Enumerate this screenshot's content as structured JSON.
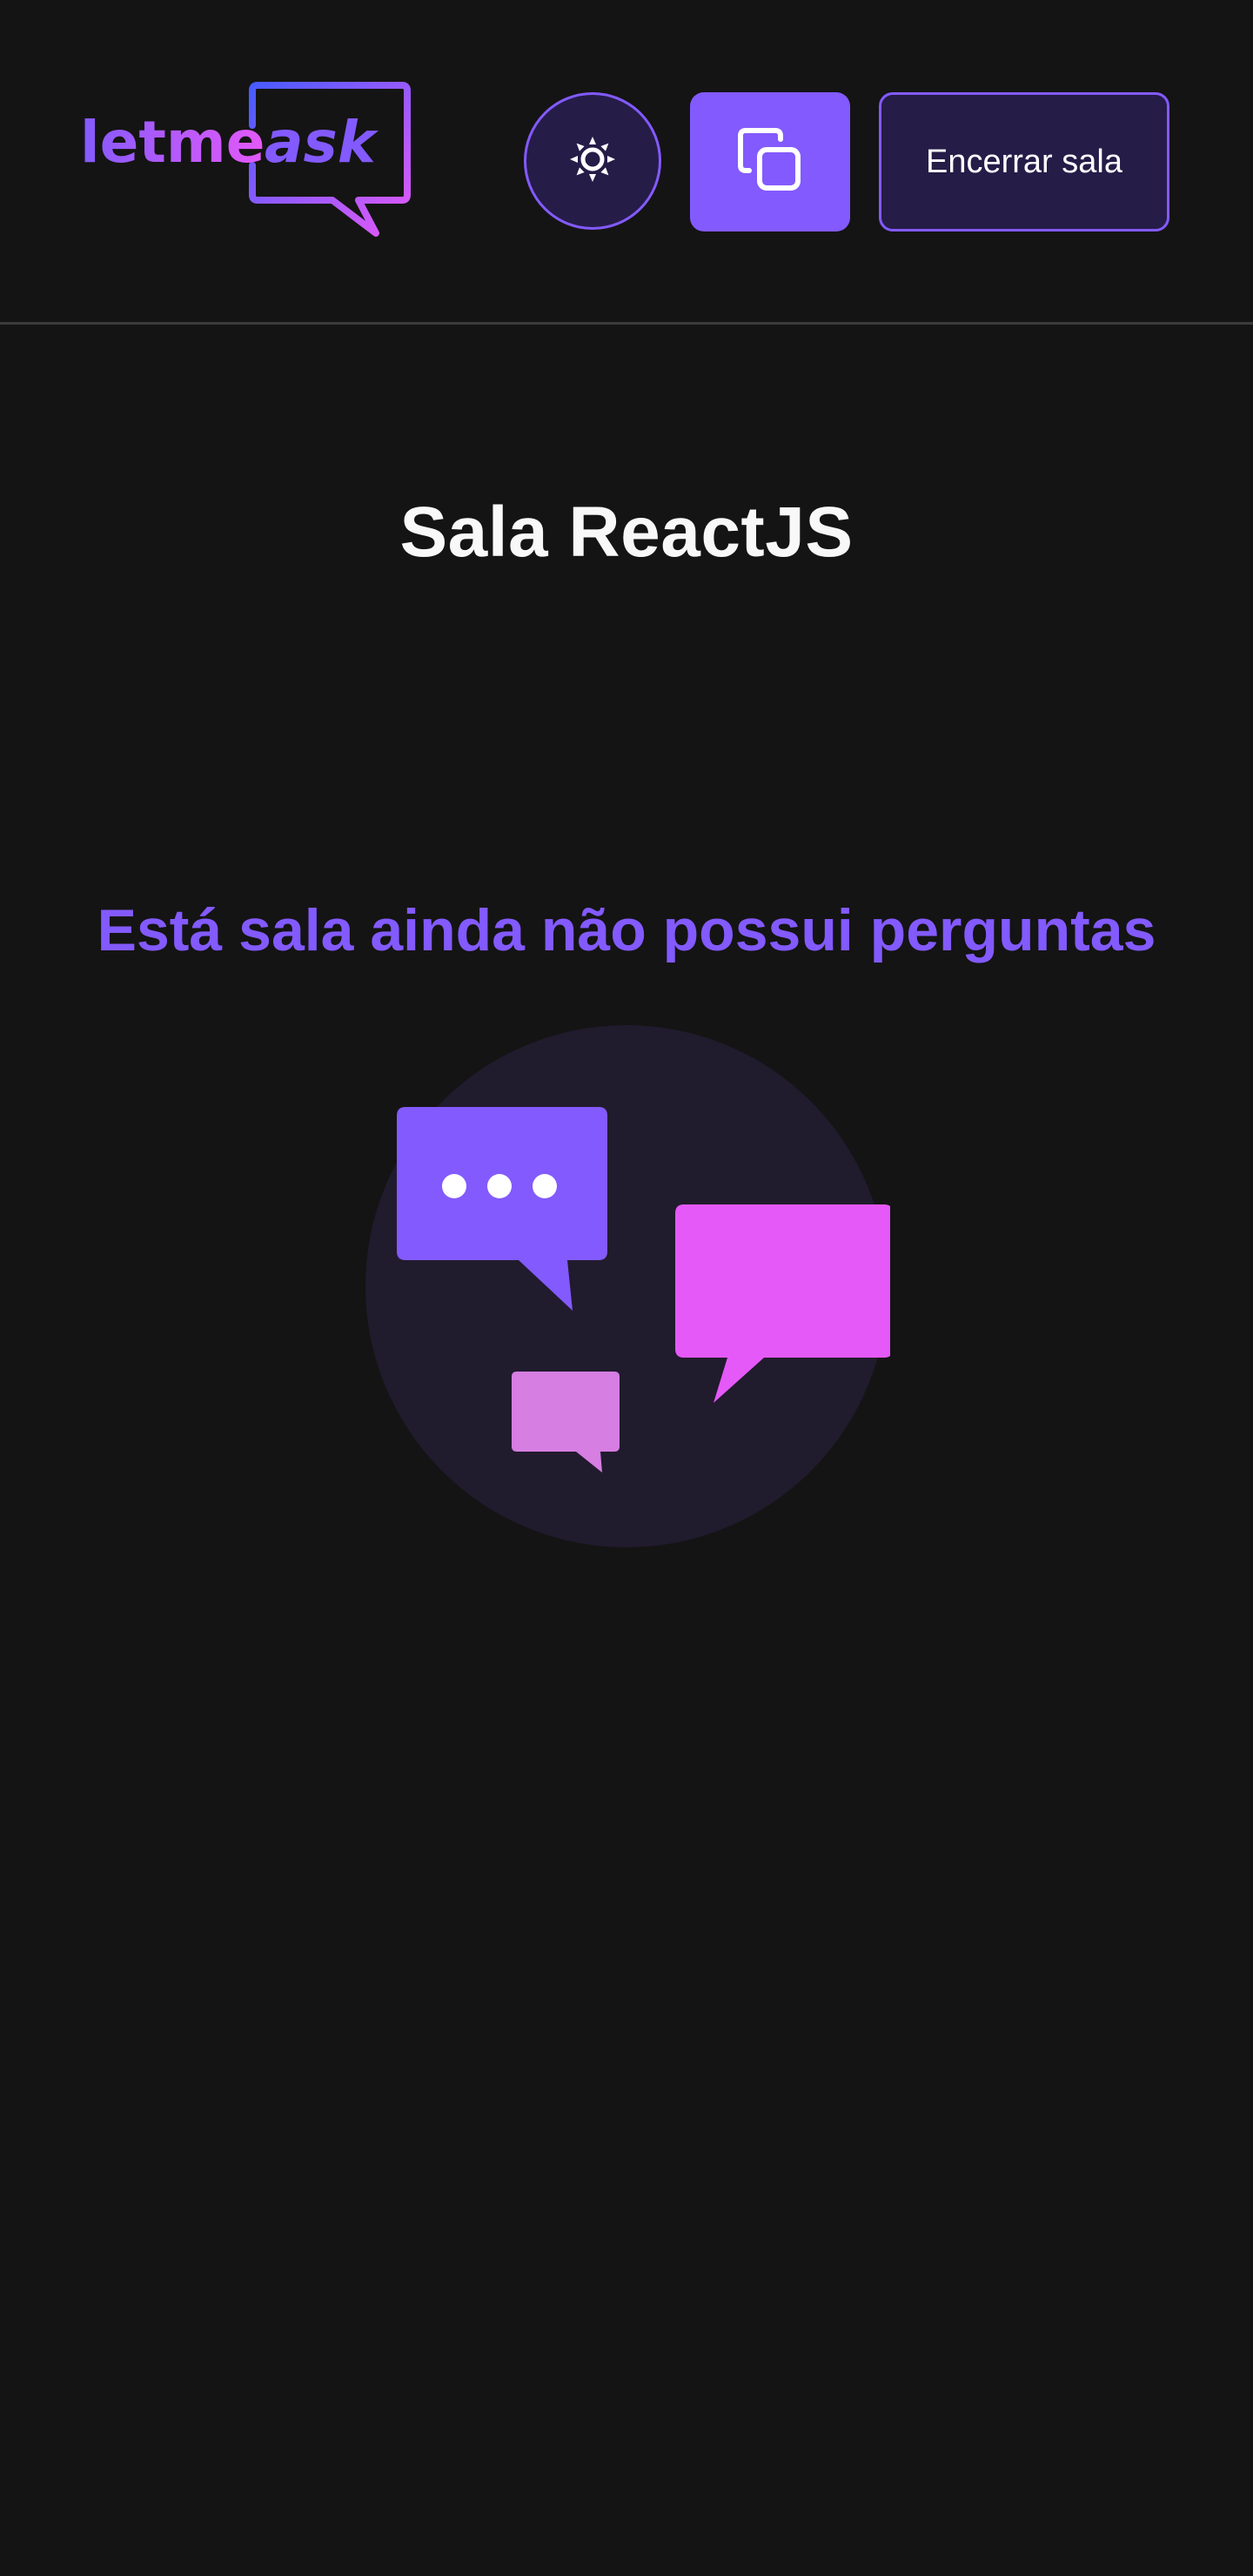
{
  "header": {
    "logo": {
      "text_primary": "letme",
      "text_secondary": "ask"
    },
    "theme_toggle": {
      "icon": "sun-icon"
    },
    "copy_room_code": {
      "icon": "copy-icon"
    },
    "close_room_label": "Encerrar sala"
  },
  "room": {
    "title": "Sala ReactJS"
  },
  "empty_state": {
    "message": "Está sala ainda não possui perguntas",
    "illustration": "empty-questions-illustration"
  },
  "colors": {
    "background": "#141414",
    "accent": "#835afd",
    "accent_pink": "#e559f9",
    "accent_light_pink": "#d67ee2",
    "button_dark": "#251c48",
    "illustration_circle": "#211b2e",
    "title_text": "#f8f8f8"
  }
}
